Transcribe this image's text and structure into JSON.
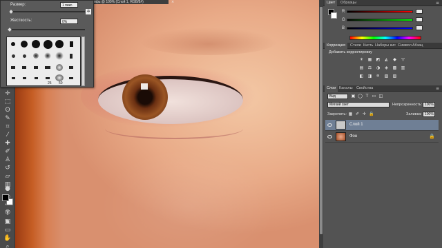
{
  "document": {
    "tab_title": "ифь @ 100% (Слой 1, RGB/8#)",
    "close_glyph": "×"
  },
  "brush_popup": {
    "size_label": "Размер:",
    "size_value": "1 пикс.",
    "hardness_label": "Жесткость:",
    "hardness_value": "0%",
    "settings_icon": "gear-icon",
    "settings_glyph": "✲",
    "brush_sizes": [
      "25",
      "50"
    ]
  },
  "toolbar": {
    "tools": [
      {
        "name": "move-tool-icon",
        "glyph": "✛"
      },
      {
        "name": "marquee-tool-icon",
        "glyph": "⬚"
      },
      {
        "name": "lasso-tool-icon",
        "glyph": "ʘ"
      },
      {
        "name": "quick-select-tool-icon",
        "glyph": "✎"
      },
      {
        "name": "crop-tool-icon",
        "glyph": "⌗"
      },
      {
        "name": "eyedropper-tool-icon",
        "glyph": "⁄"
      },
      {
        "name": "healing-brush-tool-icon",
        "glyph": "✚"
      },
      {
        "name": "brush-tool-icon",
        "glyph": "✐"
      },
      {
        "name": "clone-stamp-tool-icon",
        "glyph": "♙"
      },
      {
        "name": "history-brush-tool-icon",
        "glyph": "↺"
      },
      {
        "name": "eraser-tool-icon",
        "glyph": "▱"
      },
      {
        "name": "gradient-tool-icon",
        "glyph": "▥"
      },
      {
        "name": "blur-tool-icon",
        "glyph": "●"
      },
      {
        "name": "dodge-tool-icon",
        "glyph": "◐"
      },
      {
        "name": "pen-tool-icon",
        "glyph": "✒"
      },
      {
        "name": "type-tool-icon",
        "glyph": "T"
      },
      {
        "name": "path-select-tool-icon",
        "glyph": "↖"
      },
      {
        "name": "shape-tool-icon",
        "glyph": "▭"
      },
      {
        "name": "hand-tool-icon",
        "glyph": "✋"
      },
      {
        "name": "zoom-tool-icon",
        "glyph": "⌕"
      }
    ],
    "bottom": [
      {
        "name": "quick-mask-icon",
        "glyph": "◎"
      },
      {
        "name": "screen-mode-icon",
        "glyph": "▣"
      }
    ],
    "foreground_color": "#000000",
    "background_color": "#ffffff"
  },
  "color_panel": {
    "tabs": [
      "Цвет",
      "Образцы"
    ],
    "active_tab": "Цвет",
    "channels": [
      {
        "label": "R",
        "value": ""
      },
      {
        "label": "G",
        "value": ""
      },
      {
        "label": "B",
        "value": ""
      }
    ]
  },
  "adjustments_panel": {
    "tabs": [
      "Коррекция",
      "Стили",
      "Кисть",
      "Наборы кис",
      "Символ",
      "Абзац"
    ],
    "active_tab": "Коррекция",
    "title": "Добавить корректировку",
    "icons_row1": [
      "☀",
      "▦",
      "◩",
      "◭",
      "◆",
      "▽"
    ],
    "icons_row2": [
      "▤",
      "⚖",
      "◑",
      "◈",
      "▩",
      "▥"
    ],
    "icons_row3": [
      "◧",
      "◨",
      "⚞",
      "▧",
      "▨"
    ]
  },
  "layers_panel": {
    "tabs": [
      "Слои",
      "Каналы",
      "Свойства"
    ],
    "active_tab": "Слои",
    "filter_kind": "Вид",
    "filter_icons": [
      "▣",
      "◯",
      "T",
      "▭",
      "◫"
    ],
    "blend_mode": "Мягкий свет",
    "opacity_label": "Непрозрачность:",
    "opacity_value": "100%",
    "lock_label": "Закрепить:",
    "lock_icons": [
      "▦",
      "✐",
      "✛",
      "🔒"
    ],
    "fill_label": "Заливка:",
    "fill_value": "100%",
    "layers": [
      {
        "name": "Слой 1",
        "selected": true,
        "locked": false
      },
      {
        "name": "Фон",
        "selected": false,
        "locked": true
      }
    ],
    "lock_glyph": "🔒"
  }
}
